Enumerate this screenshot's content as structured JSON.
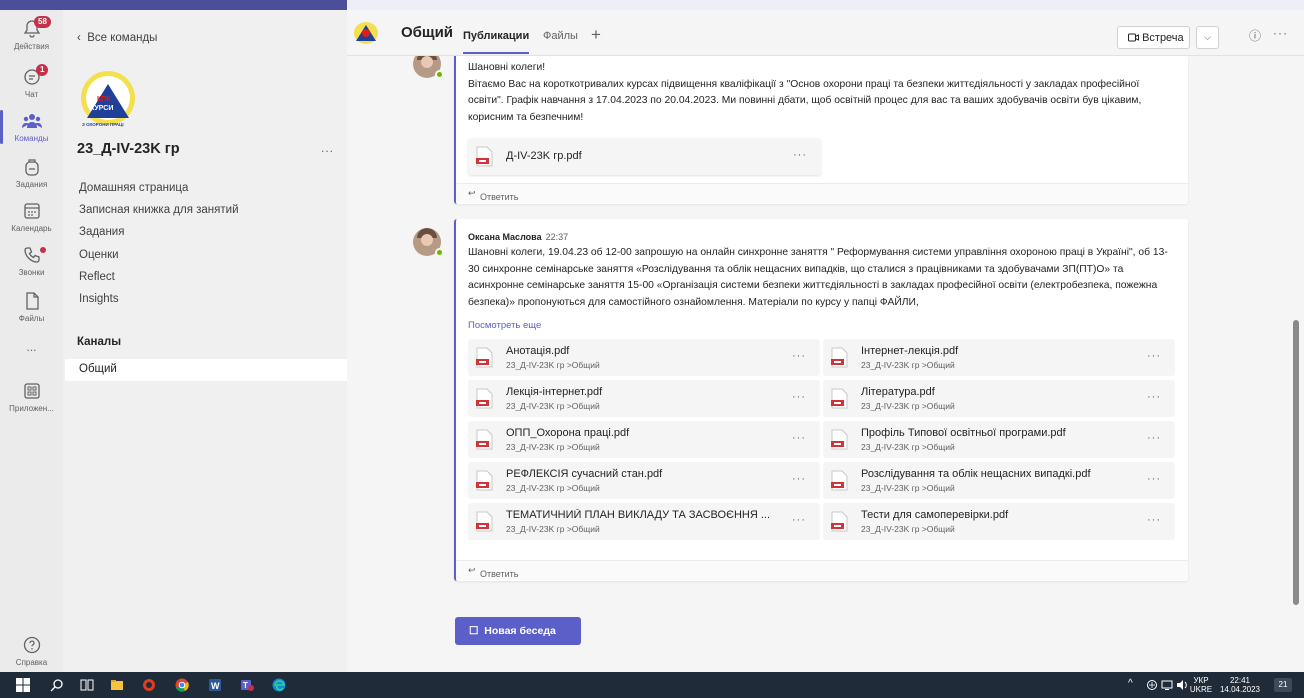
{
  "rail": {
    "activity": {
      "label": "Действия",
      "badge": "58"
    },
    "chat": {
      "label": "Чат",
      "badge": "1"
    },
    "teams": {
      "label": "Команды"
    },
    "assignments": {
      "label": "Задания"
    },
    "calendar": {
      "label": "Календарь"
    },
    "calls": {
      "label": "Звонки"
    },
    "files": {
      "label": "Файлы"
    },
    "more": {
      "label": "..."
    },
    "apps": {
      "label": "Приложен..."
    },
    "help": {
      "label": "Справка"
    }
  },
  "panel": {
    "back_label": "Все команды",
    "team_name": "23_Д-IV-23K гр",
    "team_more": "...",
    "logo_text": {
      "l1": "КПК",
      "l2": "КУРСИ",
      "l3": "З ОХОРОНИ ПРАЦІ"
    },
    "nav": [
      {
        "label": "Домашняя страница"
      },
      {
        "label": "Записная книжка для занятий"
      },
      {
        "label": "Задания"
      },
      {
        "label": "Оценки"
      },
      {
        "label": "Reflect"
      },
      {
        "label": "Insights"
      }
    ],
    "channels_header": "Каналы",
    "channels": [
      {
        "label": "Общий",
        "selected": true
      }
    ]
  },
  "header": {
    "title": "Общий",
    "tabs": [
      {
        "label": "Публикации",
        "active": true
      },
      {
        "label": "Файлы",
        "active": false
      }
    ],
    "add_tab": "+",
    "meet_label": "Встреча",
    "dropdown": "⌵",
    "info": "ⓘ",
    "more": "···"
  },
  "post1": {
    "text": "Шановні колеги!\nВітаємо Вас на короткотривалих курсах підвищення кваліфікації з \"Основ охорони праці та безпеки життєдіяльності у закладах професійної освіти\".  Графік навчання з 17.04.2023 по 20.04.2023. Ми повинні дбати, щоб освітній процес для вас та ваших здобувачів освіти був цікавим, корисним та безпечним!",
    "file": {
      "name": "Д-IV-23K гр.pdf",
      "more": "···"
    },
    "reply": "Ответить"
  },
  "post2": {
    "author": "Оксана Маслова",
    "time": "22:37",
    "text": "Шановні колеги, 19.04.23 об 12-00 запрошую на онлайн синхронне заняття \" Реформування системи управління охороною праці в Україні\", об 13-30 синхронне семінарське заняття «Розслідування та облік нещасних випадків, що сталися з працівниками та здобувачами  ЗП(ПТ)О» та асинхронне семінарське заняття 15-00 «Організація системи безпеки життєдіяльності в закладах професійної освіти (електробезпека, пожежна безпека)» пропонуються для самостійного ознайомлення. Матеріали по курсу у папці ФАЙЛИ,",
    "see_more": "Посмотреть еще",
    "files": [
      {
        "name": "Анотація.pdf",
        "path": "23_Д-IV-23K гр >Общий",
        "more": "···"
      },
      {
        "name": "Інтернет-лекція.pdf",
        "path": "23_Д-IV-23K гр >Общий",
        "more": "···"
      },
      {
        "name": "Лекція-інтернет.pdf",
        "path": "23_Д-IV-23K гр >Общий",
        "more": "···"
      },
      {
        "name": "Література.pdf",
        "path": "23_Д-IV-23K гр >Общий",
        "more": "···"
      },
      {
        "name": "ОПП_Охорона праці.pdf",
        "path": "23_Д-IV-23K гр >Общий",
        "more": "···"
      },
      {
        "name": "Профіль Типової освітньої програми.pdf",
        "path": "23_Д-IV-23K гр >Общий",
        "more": "···"
      },
      {
        "name": "РЕФЛЕКСІЯ сучасний стан.pdf",
        "path": "23_Д-IV-23K гр >Общий",
        "more": "···"
      },
      {
        "name": "Розслідування та облік нещасних випадкі.pdf",
        "path": "23_Д-IV-23K гр >Общий",
        "more": "···"
      },
      {
        "name": "ТЕМАТИЧНИЙ ПЛАН ВИКЛАДУ ТА ЗАСВОЄННЯ ...",
        "path": "23_Д-IV-23K гр >Общий",
        "more": "···"
      },
      {
        "name": "Тести для самоперевірки.pdf",
        "path": "23_Д-IV-23K гр >Общий",
        "more": "···"
      }
    ],
    "reply": "Ответить"
  },
  "new_conversation": "Новая беседа",
  "taskbar": {
    "lang": "УКР",
    "lang2": "UKRE",
    "time": "22:41",
    "date": "14.04.2023",
    "notif": "21",
    "tray_arrow": "^"
  },
  "colors": {
    "accent": "#5b5fc7",
    "rail": "#ebebeb",
    "badge": "#c4314b",
    "presence": "#6bb700"
  }
}
